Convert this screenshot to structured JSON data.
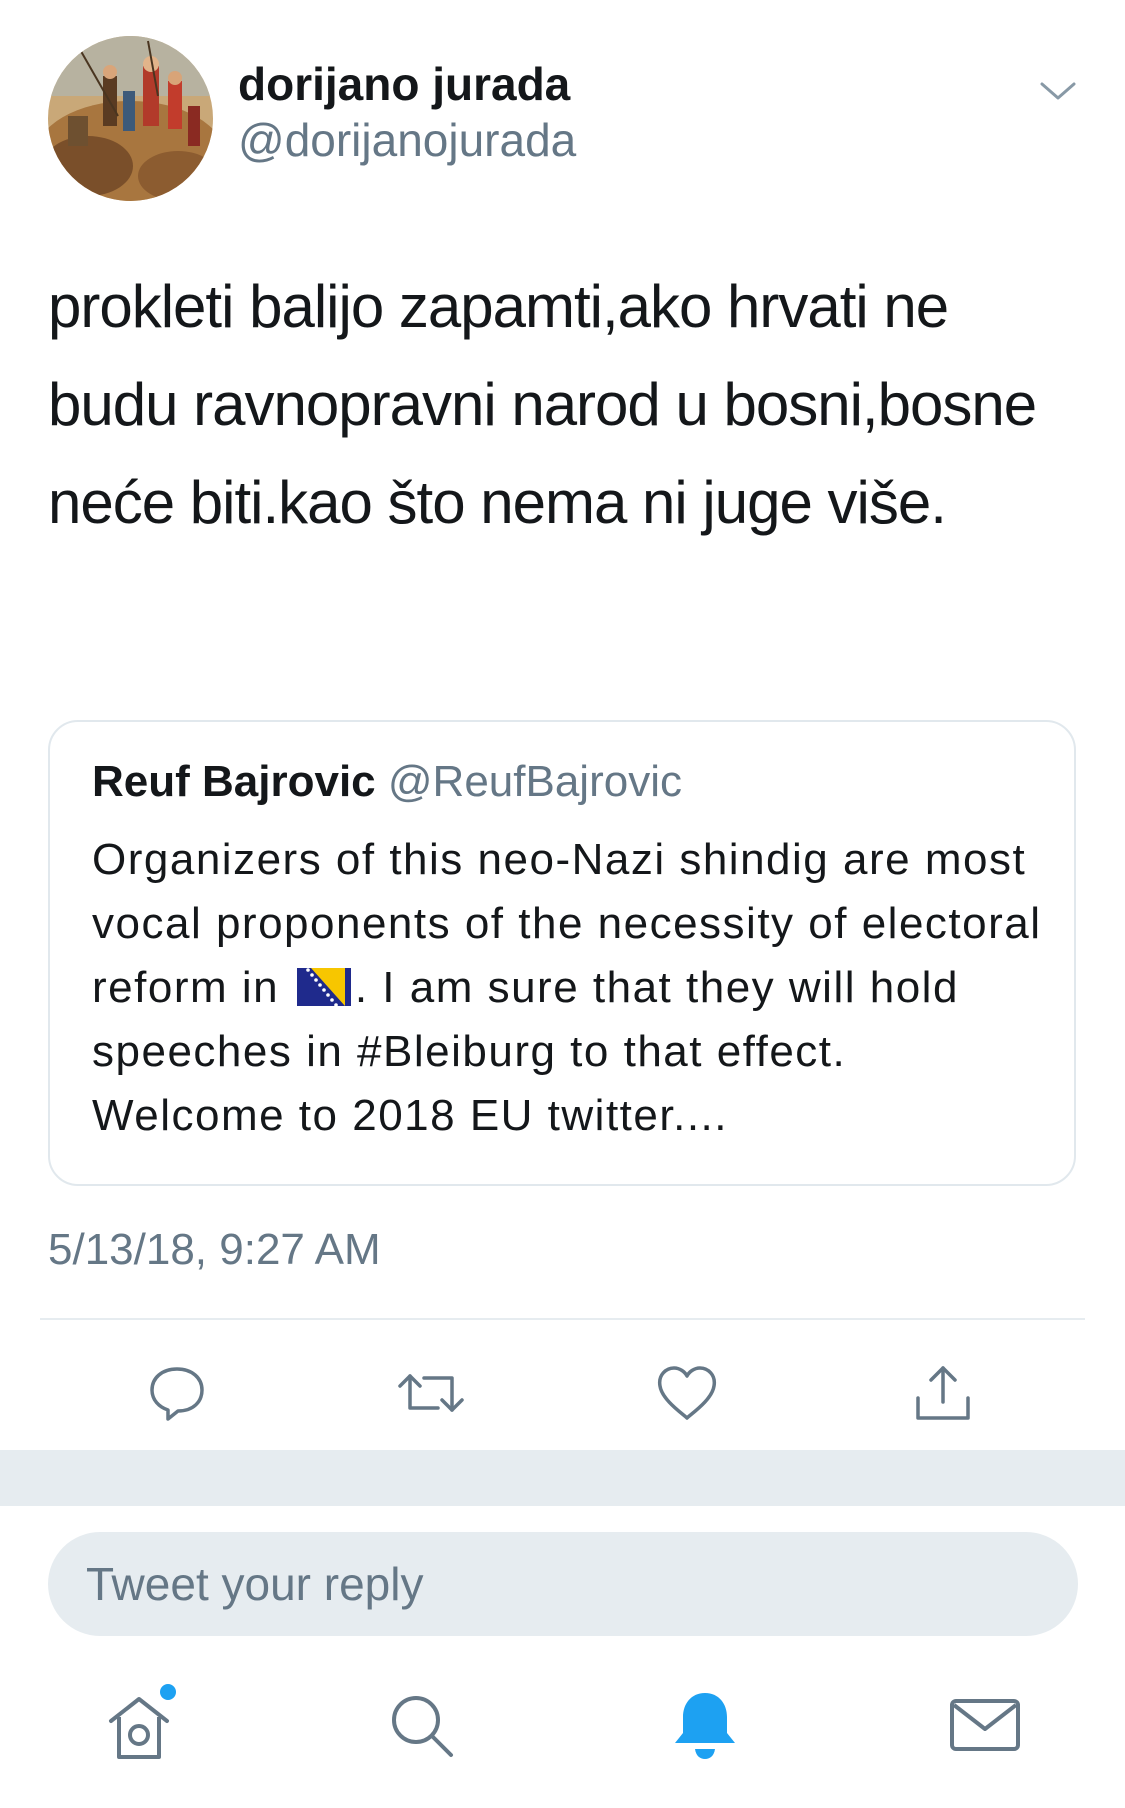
{
  "tweet": {
    "display_name": "dorijano jurada",
    "handle": "@dorijanojurada",
    "text": "prokleti balijo zapamti,ako hrvati ne budu ravnopravni narod u bosni,bosne neće biti.kao što nema ni juge više.",
    "timestamp": "5/13/18, 9:27 AM"
  },
  "quoted_tweet": {
    "display_name": "Reuf Bajrovic",
    "handle": "@ReufBajrovic",
    "text_before_flag": "Organizers of this neo-Nazi shindig are most vocal proponents of the necessity of electoral reform in ",
    "flag_icon": "bosnia-flag-emoji",
    "text_after_flag": ". I am sure that they will hold speeches in #Bleiburg to that effect. Welcome to 2018 EU twitter...."
  },
  "actions": {
    "reply_icon": "reply-icon",
    "retweet_icon": "retweet-icon",
    "like_icon": "heart-icon",
    "share_icon": "share-icon"
  },
  "reply_bar": {
    "placeholder": "Tweet your reply"
  },
  "tabbar": {
    "home_icon": "home-icon",
    "search_icon": "search-icon",
    "notifications_icon": "bell-icon",
    "messages_icon": "mail-icon",
    "home_has_new": true
  },
  "colors": {
    "text_primary": "#14171a",
    "text_secondary": "#657786",
    "accent": "#1da1f2",
    "divider": "#e6ecf0"
  }
}
